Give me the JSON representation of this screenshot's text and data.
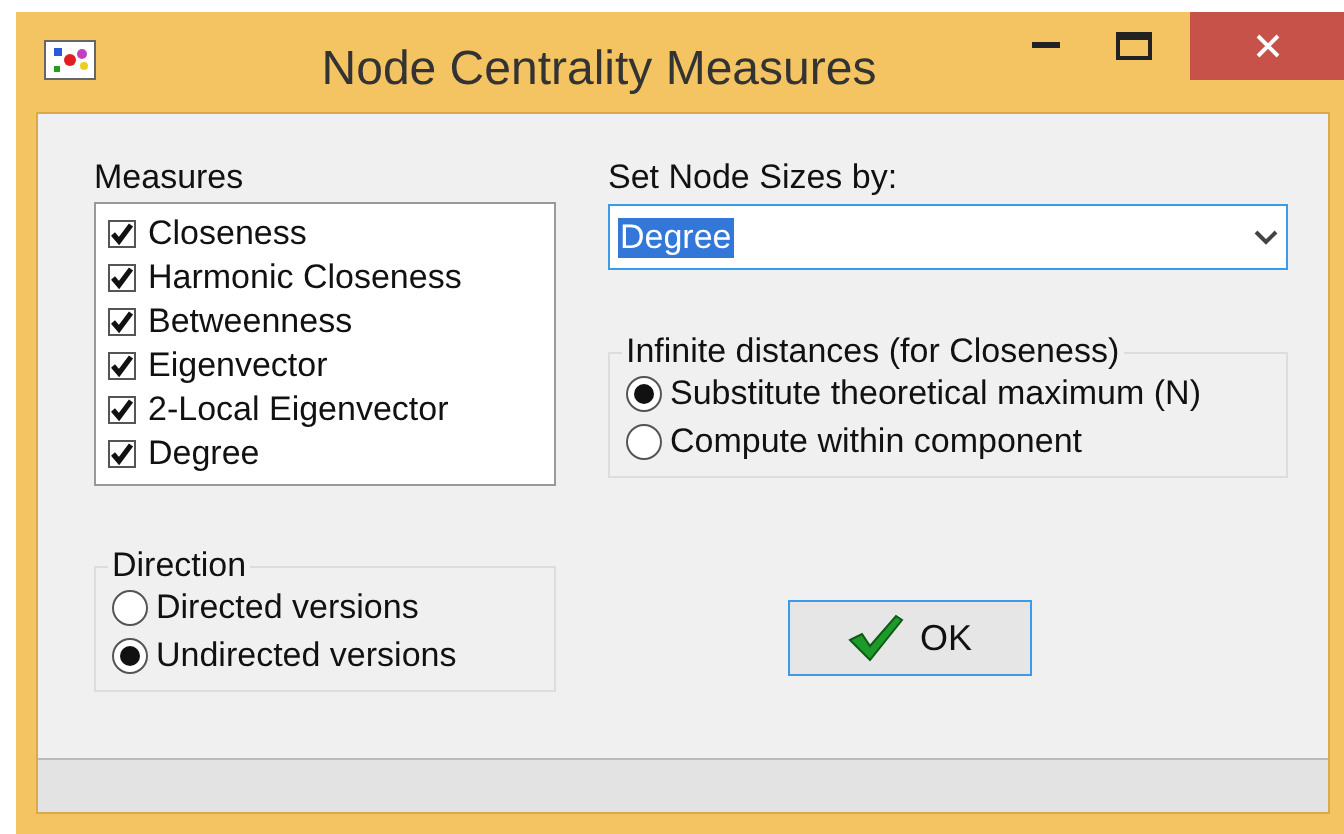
{
  "window": {
    "title": "Node Centrality Measures"
  },
  "measures": {
    "label": "Measures",
    "items": [
      {
        "label": "Closeness",
        "checked": true
      },
      {
        "label": "Harmonic Closeness",
        "checked": true
      },
      {
        "label": "Betweenness",
        "checked": true
      },
      {
        "label": "Eigenvector",
        "checked": true
      },
      {
        "label": "2-Local Eigenvector",
        "checked": true
      },
      {
        "label": "Degree",
        "checked": true
      }
    ]
  },
  "node_sizes": {
    "label": "Set Node Sizes by:",
    "value": "Degree"
  },
  "infinite_distances": {
    "label": "Infinite distances (for Closeness)",
    "options": [
      {
        "label": "Substitute theoretical maximum (N)",
        "selected": true
      },
      {
        "label": "Compute within component",
        "selected": false
      }
    ]
  },
  "direction": {
    "label": "Direction",
    "options": [
      {
        "label": "Directed versions",
        "selected": false
      },
      {
        "label": "Undirected versions",
        "selected": true
      }
    ]
  },
  "ok_button": {
    "label": "OK"
  }
}
